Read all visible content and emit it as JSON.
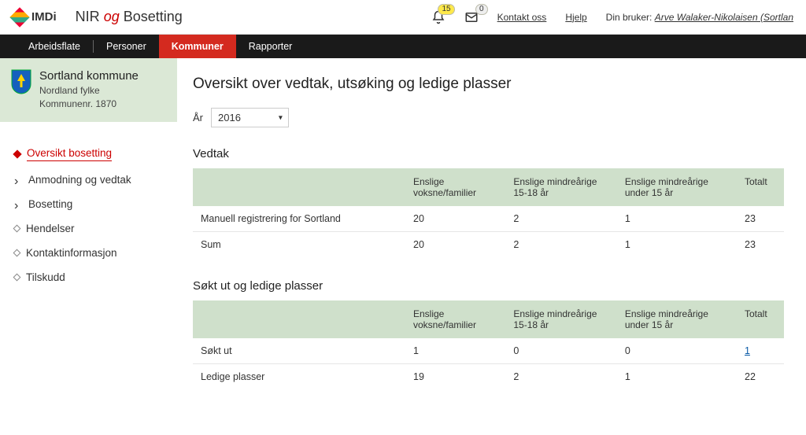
{
  "brand": "IMDi",
  "app_title_pre": "NIR",
  "app_title_mid": "og",
  "app_title_post": "Bosetting",
  "badges": {
    "bell": "15",
    "mail": "0"
  },
  "top_links": {
    "contact": "Kontakt oss",
    "help": "Hjelp",
    "user_label": "Din bruker:",
    "user_name": "Arve Walaker-Nikolaisen (Sortlan"
  },
  "nav": {
    "arbeidsflate": "Arbeidsflate",
    "personer": "Personer",
    "kommuner": "Kommuner",
    "rapporter": "Rapporter"
  },
  "kommune": {
    "name": "Sortland kommune",
    "fylke": "Nordland fylke",
    "nr": "Kommunenr. 1870"
  },
  "side": {
    "oversikt": "Oversikt bosetting",
    "anmodning": "Anmodning og vedtak",
    "bosetting": "Bosetting",
    "hendelser": "Hendelser",
    "kontakt": "Kontaktinformasjon",
    "tilskudd": "Tilskudd"
  },
  "page_title": "Oversikt over vedtak, utsøking og ledige plasser",
  "year_label": "År",
  "year_value": "2016",
  "sections": {
    "vedtak_title": "Vedtak",
    "sokt_title": "Søkt ut og ledige plasser"
  },
  "headers": {
    "c1": "",
    "c2": "Enslige voksne/familier",
    "c3": "Enslige mindreårige 15-18 år",
    "c4": "Enslige mindreårige under 15 år",
    "c5": "Totalt"
  },
  "vedtak_rows": [
    {
      "label": "Manuell registrering for Sortland",
      "c2": "20",
      "c3": "2",
      "c4": "1",
      "c5": "23"
    },
    {
      "label": "Sum",
      "c2": "20",
      "c3": "2",
      "c4": "1",
      "c5": "23"
    }
  ],
  "sokt_rows": [
    {
      "label": "Søkt ut",
      "c2": "1",
      "c3": "0",
      "c4": "0",
      "c5": "1",
      "total_link": true
    },
    {
      "label": "Ledige plasser",
      "c2": "19",
      "c3": "2",
      "c4": "1",
      "c5": "22"
    }
  ]
}
